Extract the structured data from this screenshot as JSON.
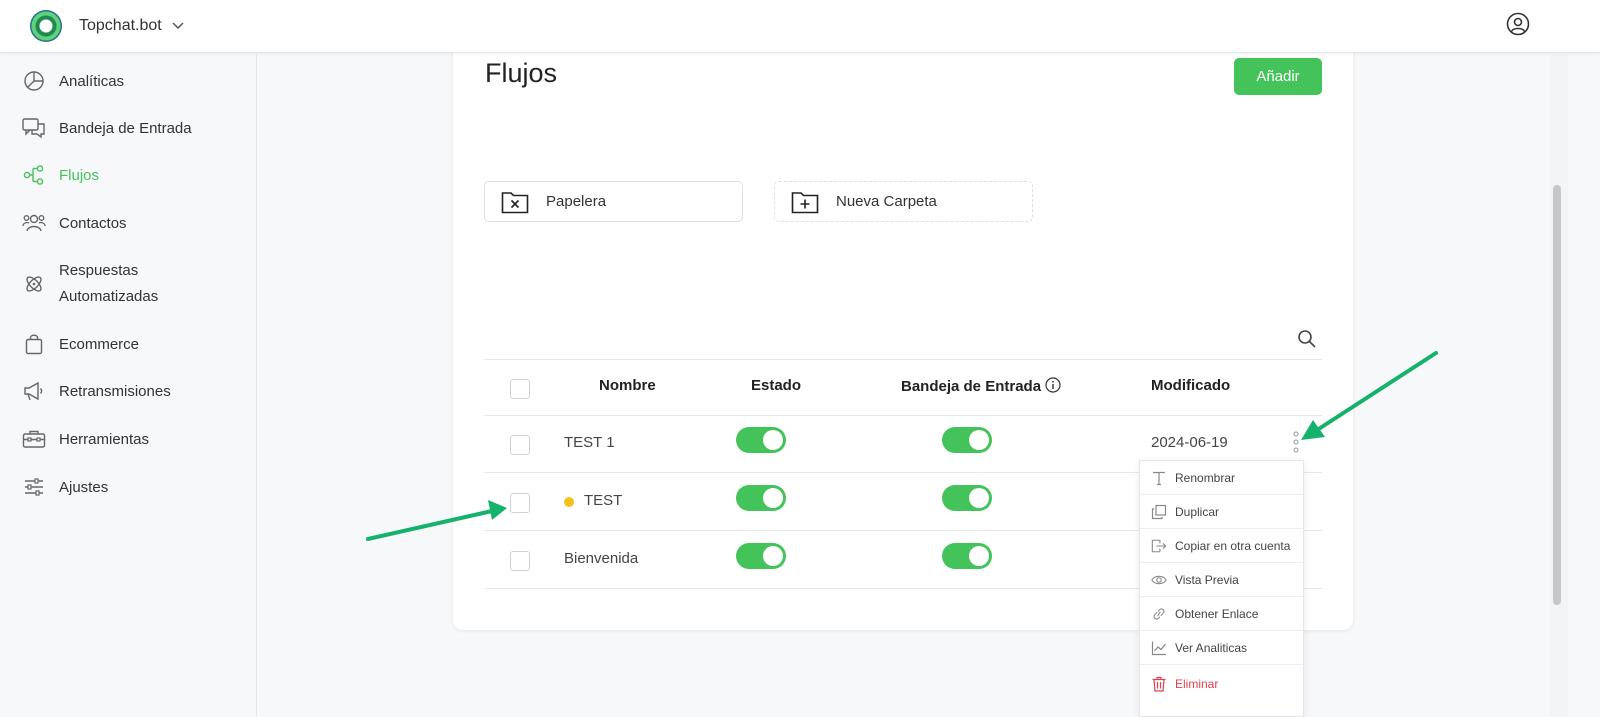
{
  "app": {
    "name": "Topchat.bot"
  },
  "sidebar": {
    "items": [
      {
        "label": "Analíticas",
        "icon": "pie-chart-icon",
        "active": false
      },
      {
        "label": "Bandeja de Entrada",
        "icon": "chat-bubbles-icon",
        "active": false
      },
      {
        "label": "Flujos",
        "icon": "flow-icon",
        "active": true
      },
      {
        "label": "Contactos",
        "icon": "users-icon",
        "active": false
      },
      {
        "label_line1": "Respuestas",
        "label_line2": "Automatizadas",
        "icon": "atom-icon",
        "active": false
      },
      {
        "label": "Ecommerce",
        "icon": "bag-icon",
        "active": false
      },
      {
        "label": "Retransmisiones",
        "icon": "megaphone-icon",
        "active": false
      },
      {
        "label": "Herramientas",
        "icon": "toolbox-icon",
        "active": false
      },
      {
        "label": "Ajustes",
        "icon": "sliders-icon",
        "active": false
      }
    ]
  },
  "main": {
    "title": "Flujos",
    "add_label": "Añadir",
    "folders": [
      {
        "label": "Papelera",
        "icon": "folder-x-icon"
      },
      {
        "label": "Nueva Carpeta",
        "icon": "folder-plus-icon"
      }
    ],
    "table": {
      "columns": [
        "Nombre",
        "Estado",
        "Bandeja de Entrada",
        "Modificado"
      ],
      "rows": [
        {
          "name": "TEST 1",
          "estado": true,
          "bandeja": true,
          "modificado": "2024-06-19"
        },
        {
          "name": "TEST",
          "estado": true,
          "bandeja": true,
          "modificado": "",
          "status_dot": "#f5c01a"
        },
        {
          "name": "Bienvenida",
          "estado": true,
          "bandeja": true,
          "modificado": ""
        }
      ]
    },
    "context_menu": {
      "items": [
        {
          "label": "Renombrar",
          "icon": "text-icon"
        },
        {
          "label": "Duplicar",
          "icon": "copy-icon"
        },
        {
          "label": "Copiar en otra cuenta",
          "icon": "export-icon"
        },
        {
          "label": "Vista Previa",
          "icon": "eye-icon"
        },
        {
          "label": "Obtener Enlace",
          "icon": "link-icon"
        },
        {
          "label": "Ver Analiticas",
          "icon": "line-chart-icon"
        },
        {
          "label": "Eliminar",
          "icon": "trash-icon"
        }
      ]
    }
  },
  "colors": {
    "accent": "#45c35b",
    "danger": "#e0424f",
    "annotation_arrow": "#14b26a"
  }
}
